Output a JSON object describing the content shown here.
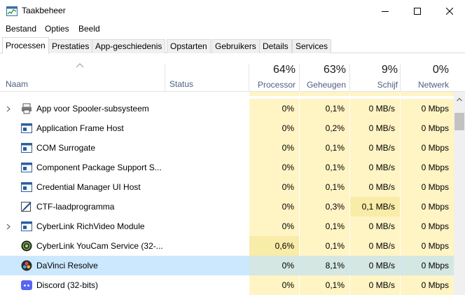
{
  "window": {
    "title": "Taakbeheer"
  },
  "menu": [
    {
      "label": "Bestand"
    },
    {
      "label": "Opties"
    },
    {
      "label": "Beeld"
    }
  ],
  "tabs": [
    {
      "label": "Processen",
      "active": true
    },
    {
      "label": "Prestaties"
    },
    {
      "label": "App-geschiedenis"
    },
    {
      "label": "Opstarten"
    },
    {
      "label": "Gebruikers"
    },
    {
      "label": "Details"
    },
    {
      "label": "Services"
    }
  ],
  "columns": {
    "name": "Naam",
    "status": "Status",
    "cpu": {
      "pct": "64%",
      "label": "Processor"
    },
    "memory": {
      "pct": "63%",
      "label": "Geheugen"
    },
    "disk": {
      "pct": "9%",
      "label": "Schijf"
    },
    "network": {
      "pct": "0%",
      "label": "Netwerk"
    }
  },
  "processes": [
    {
      "name": "App voor Spooler-subsysteem",
      "icon": "printer-icon",
      "expandable": true,
      "cpu": "0%",
      "memory": "0,1%",
      "disk": "0 MB/s",
      "network": "0 Mbps"
    },
    {
      "name": "Application Frame Host",
      "icon": "window-app-icon",
      "expandable": false,
      "cpu": "0%",
      "memory": "0,2%",
      "disk": "0 MB/s",
      "network": "0 Mbps"
    },
    {
      "name": "COM Surrogate",
      "icon": "window-app-icon",
      "expandable": false,
      "cpu": "0%",
      "memory": "0,1%",
      "disk": "0 MB/s",
      "network": "0 Mbps"
    },
    {
      "name": "Component Package Support S...",
      "icon": "window-app-icon",
      "expandable": false,
      "cpu": "0%",
      "memory": "0,1%",
      "disk": "0 MB/s",
      "network": "0 Mbps"
    },
    {
      "name": "Credential Manager UI Host",
      "icon": "window-app-icon",
      "expandable": false,
      "cpu": "0%",
      "memory": "0,1%",
      "disk": "0 MB/s",
      "network": "0 Mbps"
    },
    {
      "name": "CTF-laadprogramma",
      "icon": "pen-icon",
      "expandable": false,
      "cpu": "0%",
      "memory": "0,3%",
      "disk": "0,1 MB/s",
      "network": "0 Mbps"
    },
    {
      "name": "CyberLink RichVideo Module",
      "icon": "window-app-icon",
      "expandable": true,
      "cpu": "0%",
      "memory": "0,1%",
      "disk": "0 MB/s",
      "network": "0 Mbps"
    },
    {
      "name": "CyberLink YouCam Service (32-...",
      "icon": "camera-icon",
      "expandable": false,
      "cpu": "0,6%",
      "memory": "0,1%",
      "disk": "0 MB/s",
      "network": "0 Mbps"
    },
    {
      "name": "DaVinci Resolve",
      "icon": "davinci-icon",
      "expandable": false,
      "selected": true,
      "cpu": "0%",
      "memory": "8,1%",
      "disk": "0 MB/s",
      "network": "0 Mbps"
    },
    {
      "name": "Discord (32-bits)",
      "icon": "discord-icon",
      "expandable": false,
      "cpu": "0%",
      "memory": "0,1%",
      "disk": "0 MB/s",
      "network": "0 Mbps"
    }
  ]
}
